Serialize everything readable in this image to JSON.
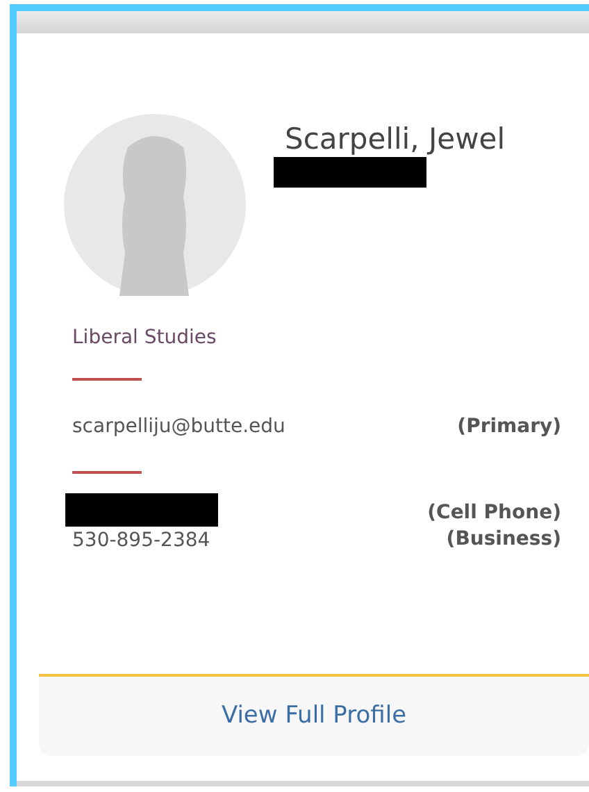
{
  "profile": {
    "name": "Scarpelli, Jewel",
    "title_redacted": true,
    "department": "Liberal Studies"
  },
  "email": {
    "address": "scarpelliju@butte.edu",
    "label": "(Primary)"
  },
  "phones": [
    {
      "kind": "redacted",
      "label": "(Cell Phone)"
    },
    {
      "kind": "number",
      "number": "530-895-2384",
      "label": "(Business)"
    }
  ],
  "footer": {
    "link": "View Full Profile"
  }
}
